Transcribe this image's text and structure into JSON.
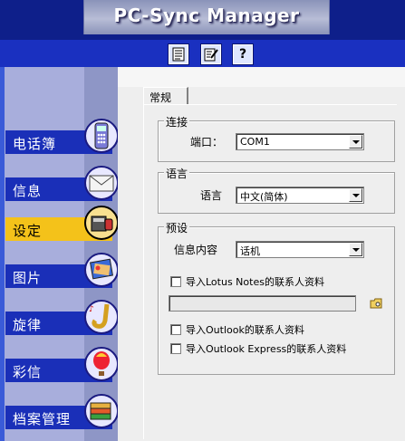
{
  "app": {
    "title": "PC-Sync Manager"
  },
  "toolbar": {
    "buttons": [
      {
        "icon": "document-list-icon"
      },
      {
        "icon": "edit-document-icon"
      },
      {
        "icon": "help-icon",
        "label": "?"
      }
    ]
  },
  "sidebar": {
    "items": [
      {
        "label": "电话簿",
        "icon": "phone-icon"
      },
      {
        "label": "信息",
        "icon": "envelope-icon"
      },
      {
        "label": "设定",
        "icon": "settings-icon",
        "active": true
      },
      {
        "label": "图片",
        "icon": "picture-icon"
      },
      {
        "label": "旋律",
        "icon": "saxophone-icon"
      },
      {
        "label": "彩信",
        "icon": "balloon-icon"
      },
      {
        "label": "档案管理",
        "icon": "files-icon"
      }
    ]
  },
  "tab": {
    "label": "常规"
  },
  "connection": {
    "legend": "连接",
    "port_label": "端口：",
    "port_value": "COM1"
  },
  "language": {
    "legend": "语言",
    "label": "语言",
    "value": "中文(简体)"
  },
  "preset": {
    "legend": "预设",
    "content_label": "信息内容",
    "content_value": "话机",
    "import_lotus": "导入Lotus Notes的联系人资料",
    "import_outlook": "导入Outlook的联系人资料",
    "import_outlook_express": "导入Outlook Express的联系人资料"
  },
  "colors": {
    "header": "#0e1f8a",
    "toolbar": "#1a30c0",
    "nav": "#1a2fb8",
    "nav_active": "#f4c21a",
    "panel": "#eeeeee"
  }
}
